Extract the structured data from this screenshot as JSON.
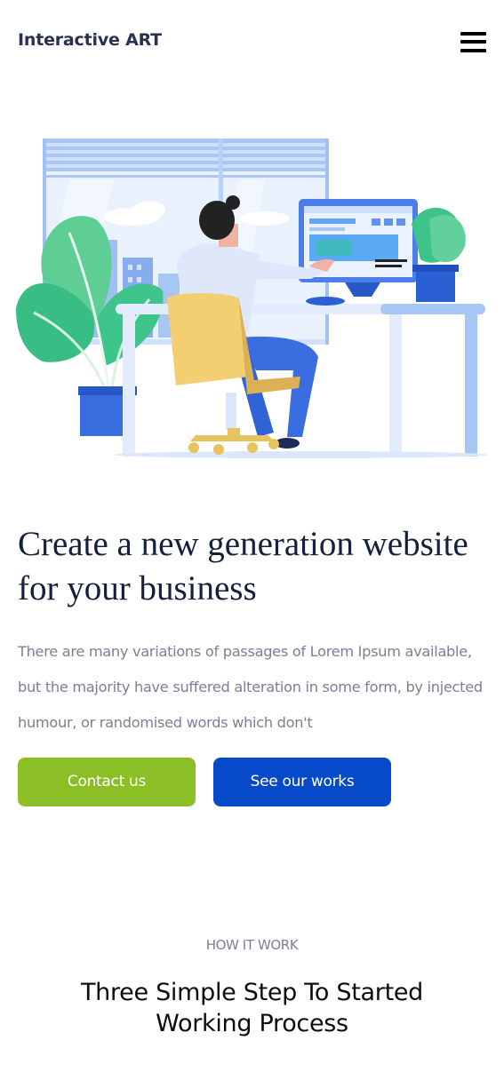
{
  "header": {
    "logo_text": "Interactive ART",
    "menu_icon": "hamburger-menu-icon"
  },
  "hero": {
    "title": "Create a new generation website for your business",
    "description": "There are many variations of passages of Lorem Ipsum available, but the majority have suffered alteration in some form, by injected humour, or randomised words which don't",
    "illustration": "person-working-at-desk-illustration",
    "buttons": {
      "contact_label": "Contact us",
      "works_label": "See our works"
    }
  },
  "how_it_works": {
    "tag": "HOW IT WORK",
    "title": "Three Simple Step To Started Working Process"
  },
  "colors": {
    "accent_green": "#8cbf26",
    "accent_blue": "#0649c9",
    "heading_dark": "#14213d",
    "body_text": "#7b8096"
  }
}
